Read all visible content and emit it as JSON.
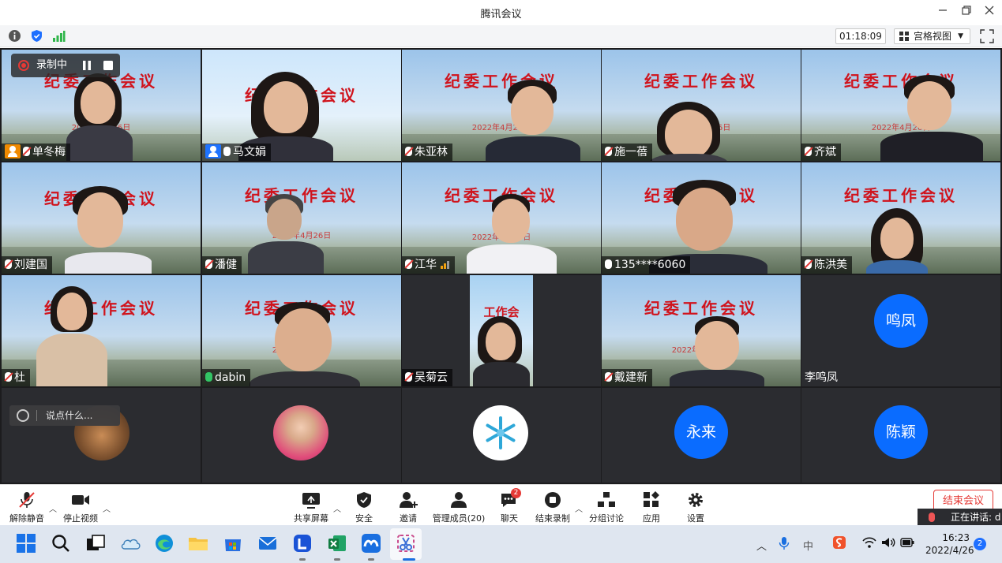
{
  "window": {
    "title": "腾讯会议",
    "minimize_icon": "minimize-icon",
    "restore_icon": "restore-icon",
    "close_icon": "close-icon"
  },
  "infobar": {
    "timer": "01:18:09",
    "view_label": "宫格视图"
  },
  "recording": {
    "label": "录制中"
  },
  "banner": {
    "text": "纪委工作会议",
    "date": "2022年4月26日"
  },
  "participants": [
    {
      "name": "单冬梅",
      "mic": "muted",
      "role": "host"
    },
    {
      "name": "马文娟",
      "mic": "on",
      "role": "cohost"
    },
    {
      "name": "朱亚林",
      "mic": "muted"
    },
    {
      "name": "施一蓓",
      "mic": "muted"
    },
    {
      "name": "齐斌",
      "mic": "muted"
    },
    {
      "name": "刘建国",
      "mic": "muted"
    },
    {
      "name": "潘健",
      "mic": "muted"
    },
    {
      "name": "江华",
      "mic": "muted",
      "signal": true
    },
    {
      "name": "135****6060",
      "mic": "on"
    },
    {
      "name": "陈洪美",
      "mic": "muted"
    },
    {
      "name": "杜",
      "mic": "muted"
    },
    {
      "name": "dabin",
      "mic": "speaking"
    },
    {
      "name": "吴菊云",
      "mic": "muted"
    },
    {
      "name": "戴建新",
      "mic": "muted"
    },
    {
      "name": "李鸣凤",
      "avatar": "鸣凤"
    }
  ],
  "audio_only": [
    {
      "avatar": "永来"
    },
    {
      "avatar": "陈颖"
    }
  ],
  "chat_input": {
    "placeholder": "说点什么..."
  },
  "toolbar": {
    "unmute": "解除静音",
    "stop_video": "停止视频",
    "share_screen": "共享屏幕",
    "security": "安全",
    "invite": "邀请",
    "manage_members": "管理成员(20)",
    "chat": "聊天",
    "chat_badge": "2",
    "end_recording": "结束录制",
    "breakout": "分组讨论",
    "apps": "应用",
    "settings": "设置",
    "end_meeting": "结束会议",
    "speaking": "正在讲话: d"
  },
  "taskbar": {
    "time": "16:23",
    "date": "2022/4/26",
    "notifications": "2",
    "ime": "中"
  }
}
